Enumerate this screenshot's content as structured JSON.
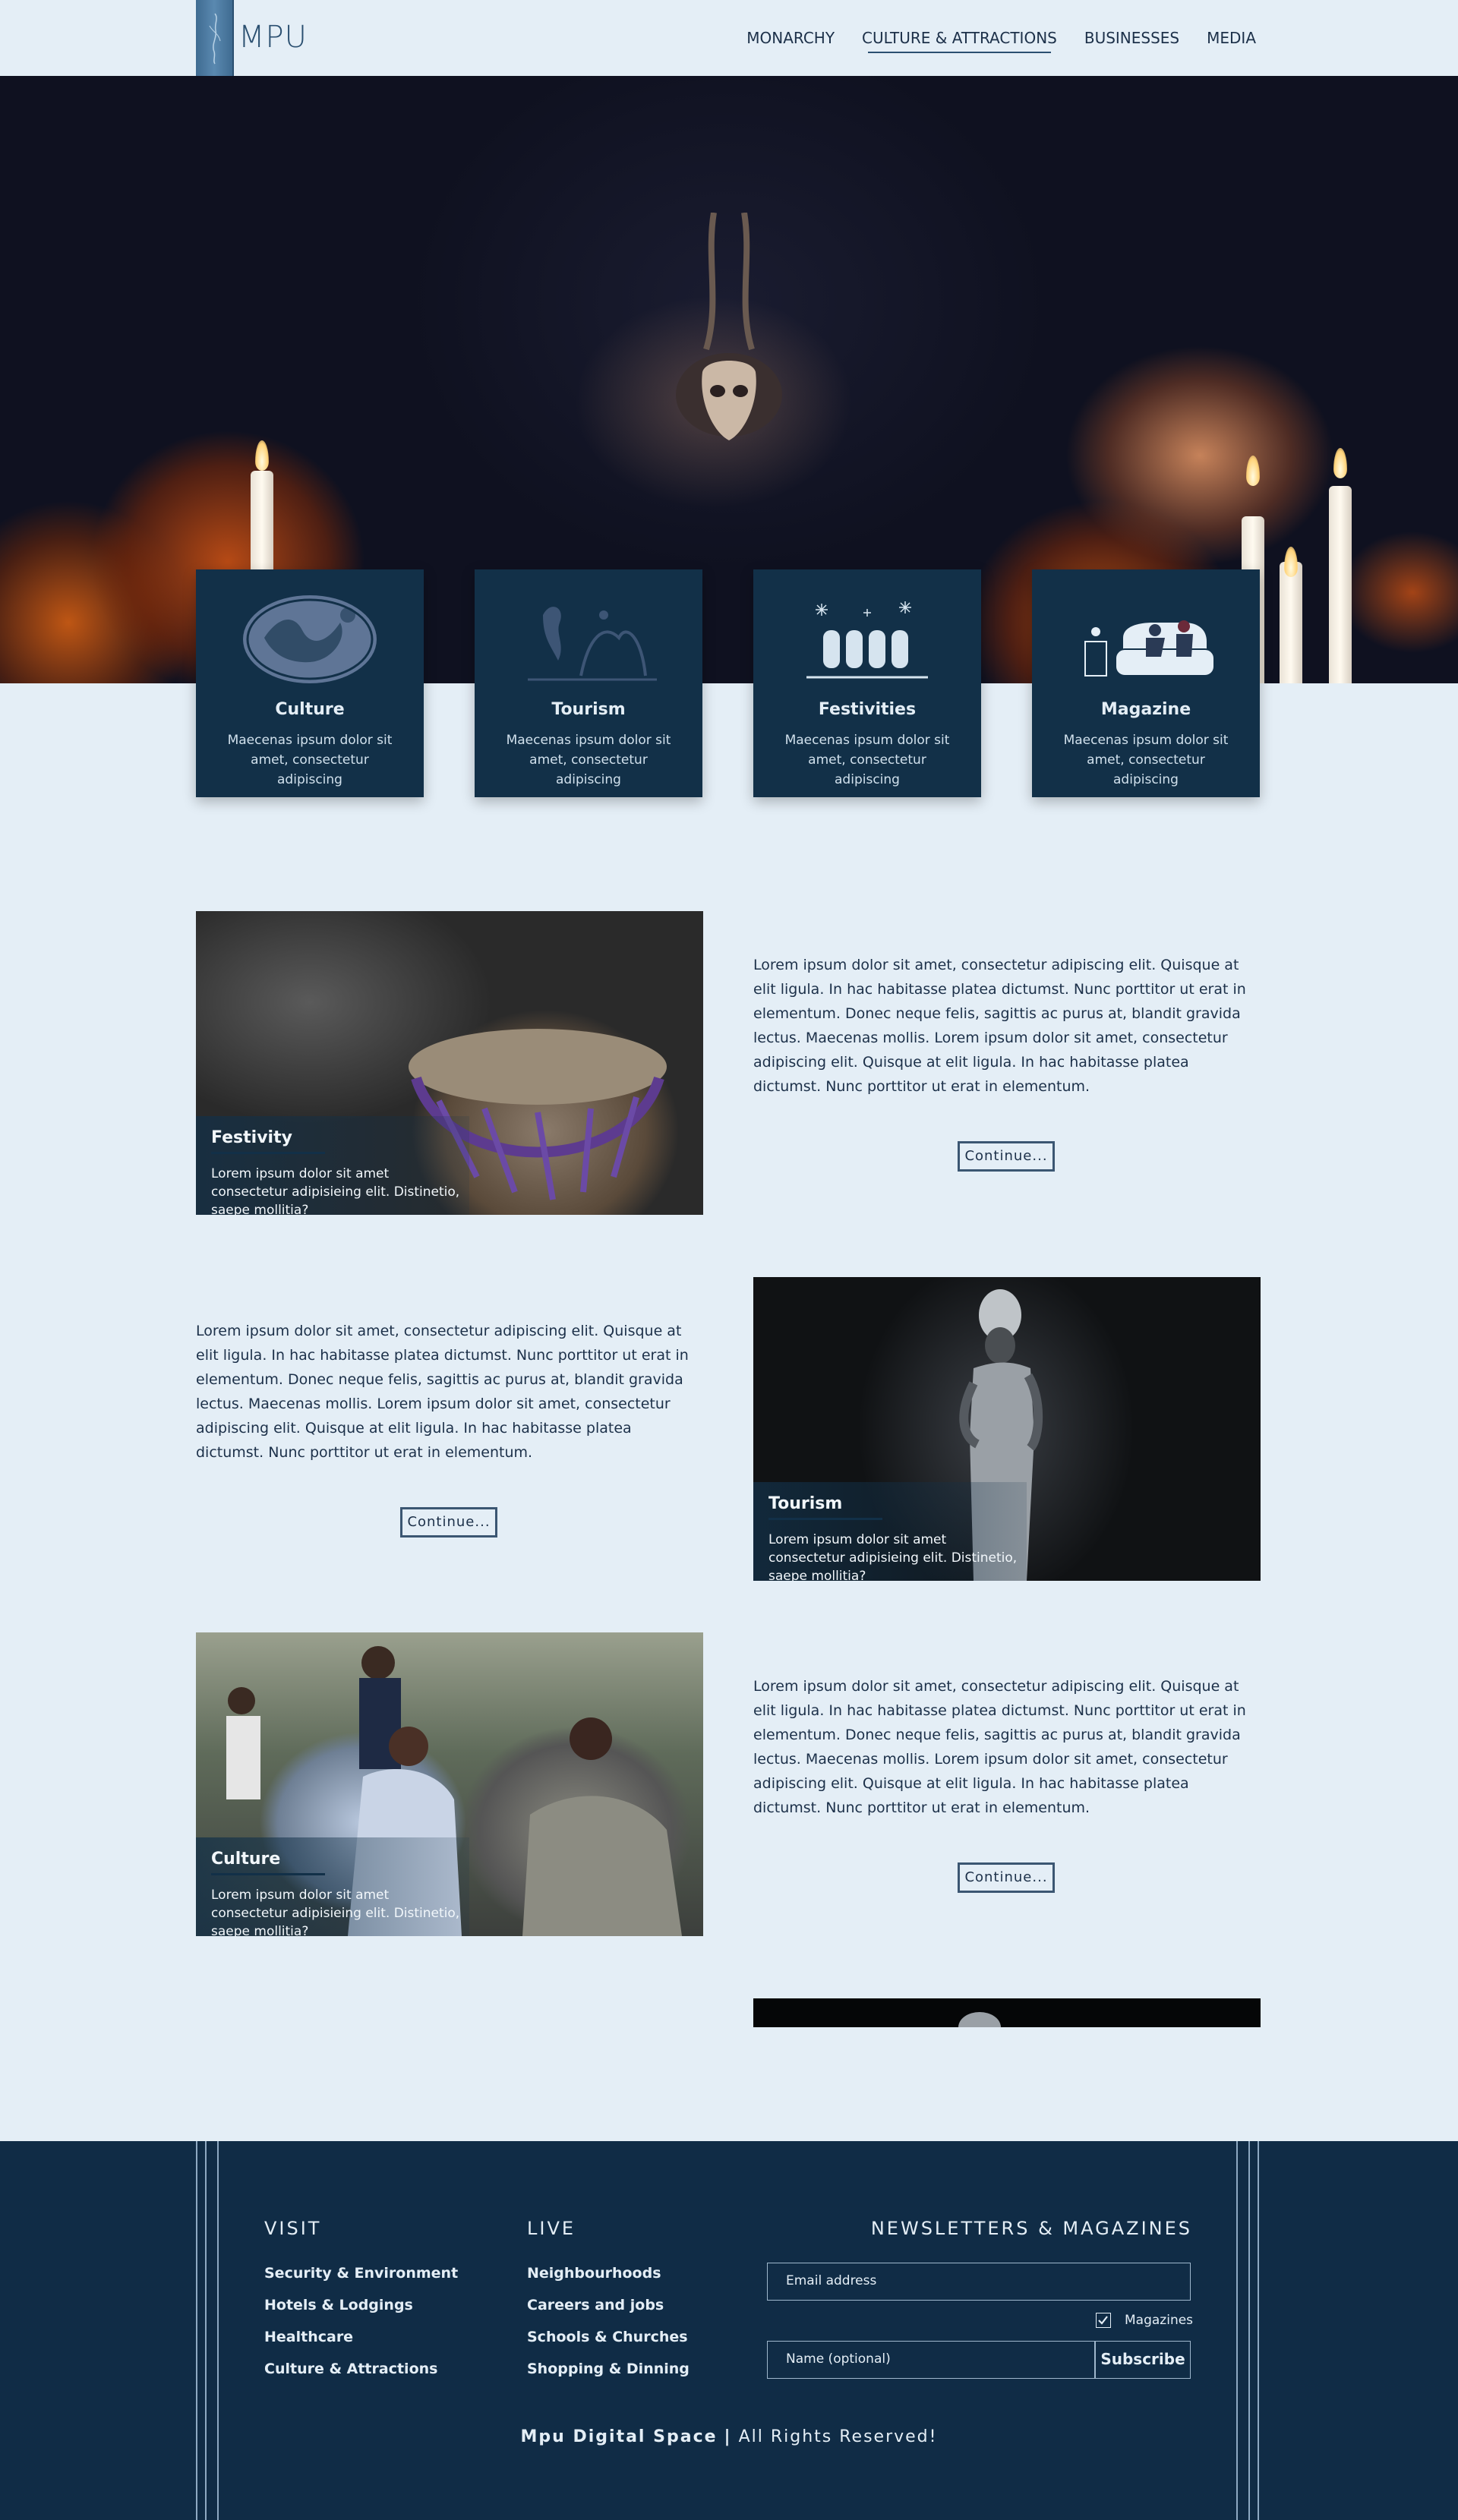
{
  "brand": {
    "logo_text": "MPU"
  },
  "nav": {
    "items": [
      {
        "label": "MONARCHY"
      },
      {
        "label": "CULTURE & ATTRACTIONS"
      },
      {
        "label": "BUSINESSES"
      },
      {
        "label": "MEDIA"
      }
    ],
    "active_index": 1
  },
  "categories": [
    {
      "title": "Culture",
      "desc": "Maecenas ipsum dolor sit amet, consectetur adipiscing",
      "icon": "culture-illustration-icon"
    },
    {
      "title": "Tourism",
      "desc": "Maecenas ipsum dolor sit amet, consectetur adipiscing",
      "icon": "tourism-illustration-icon"
    },
    {
      "title": "Festivities",
      "desc": "Maecenas ipsum dolor sit amet, consectetur adipiscing",
      "icon": "festivities-illustration-icon"
    },
    {
      "title": "Magazine",
      "desc": "Maecenas ipsum dolor sit amet, consectetur adipiscing",
      "icon": "magazine-illustration-icon"
    }
  ],
  "features": [
    {
      "caption_title": "Festivity",
      "caption_desc": "Lorem ipsum dolor sit amet consectetur adipisieing elit. Distinetio, saepe mollitia?",
      "body": "Lorem ipsum dolor sit amet, consectetur adipiscing elit. Quisque at elit ligula. In hac habitasse platea dictumst. Nunc porttitor ut erat in elementum. Donec neque felis, sagittis ac purus at, blandit gravida lectus. Maecenas mollis. Lorem ipsum dolor sit amet, consectetur adipiscing elit. Quisque at elit ligula. In hac habitasse platea dictumst. Nunc porttitor ut erat in elementum.",
      "button": "Continue..."
    },
    {
      "caption_title": "Tourism",
      "caption_desc": "Lorem ipsum dolor sit amet consectetur adipisieing elit. Distinetio, saepe mollitia?",
      "body": "Lorem ipsum dolor sit amet, consectetur adipiscing elit. Quisque at elit ligula. In hac habitasse platea dictumst. Nunc porttitor ut erat in elementum. Donec neque felis, sagittis ac purus at, blandit gravida lectus. Maecenas mollis. Lorem ipsum dolor sit amet, consectetur adipiscing elit. Quisque at elit ligula. In hac habitasse platea dictumst. Nunc porttitor ut erat in elementum.",
      "button": "Continue..."
    },
    {
      "caption_title": "Culture",
      "caption_desc": "Lorem ipsum dolor sit amet consectetur adipisieing elit. Distinetio, saepe mollitia?",
      "body": "Lorem ipsum dolor sit amet, consectetur adipiscing elit. Quisque at elit ligula. In hac habitasse platea dictumst. Nunc porttitor ut erat in elementum. Donec neque felis, sagittis ac purus at, blandit gravida lectus. Maecenas mollis. Lorem ipsum dolor sit amet, consectetur adipiscing elit. Quisque at elit ligula. In hac habitasse platea dictumst. Nunc porttitor ut erat in elementum.",
      "button": "Continue..."
    }
  ],
  "footer": {
    "visit": {
      "heading": "VISIT",
      "links": [
        "Security & Environment",
        "Hotels & Lodgings",
        "Healthcare",
        "Culture & Attractions"
      ]
    },
    "live": {
      "heading": "LIVE",
      "links": [
        "Neighbourhoods",
        "Careers and jobs",
        "Schools & Churches",
        "Shopping & Dinning"
      ]
    },
    "newsletter": {
      "heading": "NEWSLETTERS & MAGAZINES",
      "email_placeholder": "Email address",
      "checkbox_label": "Magazines",
      "checkbox_checked": true,
      "name_placeholder": "Name (optional)",
      "subscribe_label": "Subscribe"
    },
    "copyright_brand": "Mpu Digital Space",
    "copyright_sep": "|",
    "copyright_text": "All Rights Reserved!"
  },
  "colors": {
    "page_bg": "#e4eef6",
    "navy": "#123048",
    "footer_bg": "#102c46",
    "text": "#1c3049"
  }
}
